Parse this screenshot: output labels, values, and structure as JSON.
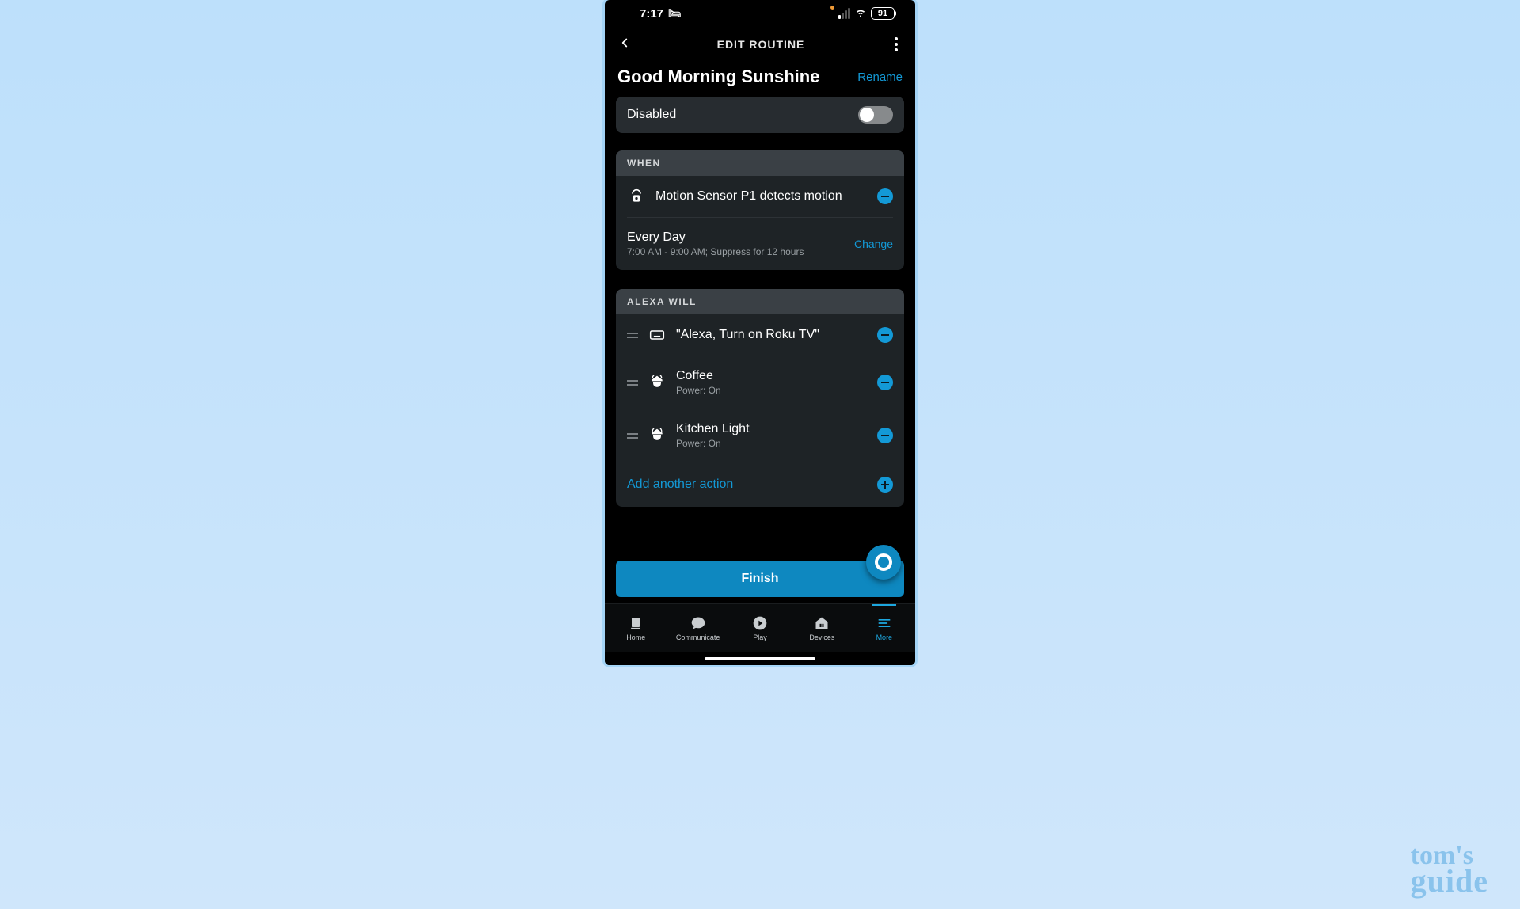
{
  "status": {
    "time": "7:17",
    "battery": "91"
  },
  "header": {
    "title": "EDIT ROUTINE"
  },
  "routine": {
    "name": "Good Morning Sunshine",
    "rename": "Rename"
  },
  "disabled": {
    "label": "Disabled"
  },
  "when": {
    "header": "WHEN",
    "trigger": "Motion Sensor P1 detects motion",
    "schedule_title": "Every Day",
    "schedule_detail": "7:00 AM - 9:00 AM; Suppress for 12 hours",
    "change": "Change"
  },
  "alexa_will": {
    "header": "ALEXA WILL",
    "actions": [
      {
        "title": "\"Alexa, Turn on Roku TV\"",
        "subtitle": "",
        "icon": "keyboard"
      },
      {
        "title": "Coffee",
        "subtitle": "Power: On",
        "icon": "plug"
      },
      {
        "title": "Kitchen Light",
        "subtitle": "Power: On",
        "icon": "plug"
      }
    ],
    "add": "Add another action"
  },
  "finish": "Finish",
  "tabs": {
    "home": "Home",
    "communicate": "Communicate",
    "play": "Play",
    "devices": "Devices",
    "more": "More"
  },
  "watermark": {
    "line1": "tom's",
    "line2": "guide"
  }
}
